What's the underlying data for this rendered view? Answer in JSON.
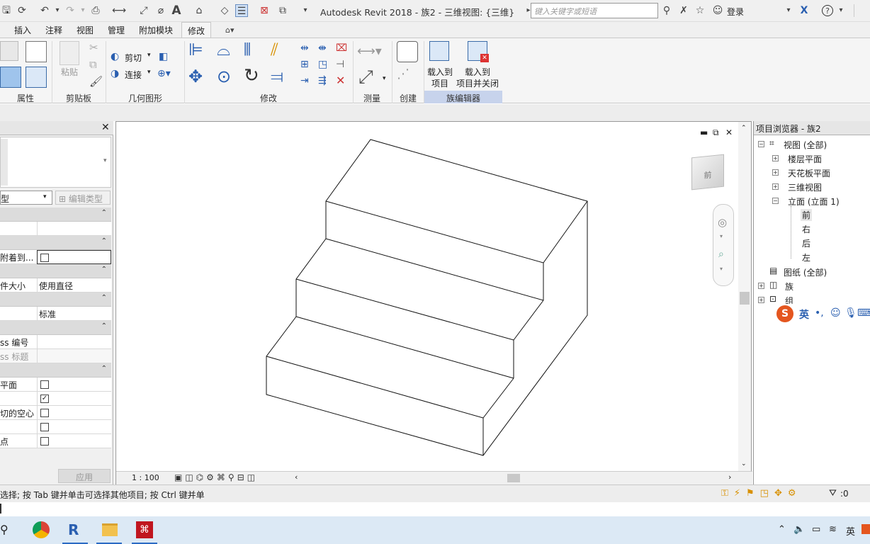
{
  "app": {
    "title": "Autodesk Revit 2018 -   族2 - 三维视图: {三维}"
  },
  "search": {
    "placeholder": "键入关键字或短语"
  },
  "header": {
    "login": "登录"
  },
  "ribbon": {
    "tabs": [
      "插入",
      "注释",
      "视图",
      "管理",
      "附加模块",
      "修改"
    ],
    "active_tab": "修改",
    "panels": {
      "properties": "属性",
      "clipboard": "剪贴板",
      "geometry": "几何图形",
      "modify": "修改",
      "measure": "测量",
      "create": "创建",
      "family_editor": "族编辑器"
    },
    "paste": "粘贴",
    "cut": "剪切",
    "join": "连接",
    "load_into_project": [
      "载入到",
      "项目"
    ],
    "load_into_project_close": [
      "载入到",
      "项目并关闭"
    ]
  },
  "properties": {
    "type_selector": "型",
    "edit_type": "编辑类型",
    "rows": [
      {
        "k": "附着到...",
        "v": ""
      },
      {
        "k": "件大小",
        "v": "使用直径"
      },
      {
        "k": "",
        "v": "标准"
      },
      {
        "k": "ss 编号",
        "v": ""
      },
      {
        "k": "ss 标题",
        "v": ""
      },
      {
        "k": "平面",
        "v": ""
      },
      {
        "k": "切的空心",
        "v": ""
      },
      {
        "k": "点",
        "v": ""
      }
    ],
    "apply": "应用"
  },
  "view": {
    "scale": "1 : 100",
    "viewcube_face": "前"
  },
  "browser": {
    "title": "项目浏览器 - 族2",
    "nodes": {
      "views": "视图 (全部)",
      "floor": "楼层平面",
      "ceiling": "天花板平面",
      "three_d": "三维视图",
      "elev": "立面 (立面 1)",
      "front": "前",
      "right": "右",
      "back": "后",
      "left": "左",
      "sheets": "图纸 (全部)",
      "families": "族",
      "groups": "组"
    },
    "ime": "英"
  },
  "status": {
    "text": "选择; 按 Tab 键并单击可选择其他项目; 按 Ctrl 键并单",
    "filter": ":0"
  },
  "taskbar": {
    "tray_lang": "英"
  }
}
